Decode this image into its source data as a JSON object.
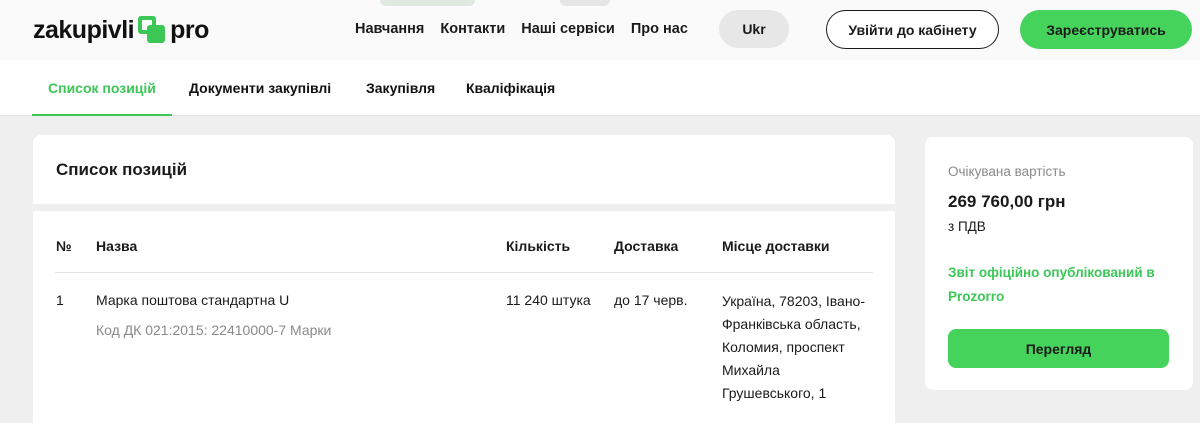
{
  "header": {
    "logo_left": "zakupivli",
    "logo_right": "pro",
    "nav": [
      "Навчання",
      "Контакти",
      "Наші сервіси",
      "Про нас"
    ],
    "lang": "Ukr",
    "login_label": "Увійти до кабінету",
    "register_label": "Зареєструватись"
  },
  "tabs": [
    {
      "label": "Список позицій",
      "active": true
    },
    {
      "label": "Документи закупівлі",
      "active": false
    },
    {
      "label": "Закупівля",
      "active": false
    },
    {
      "label": "Кваліфікація",
      "active": false
    }
  ],
  "items_card": {
    "title": "Список позицій",
    "columns": [
      "№",
      "Назва",
      "Кількість",
      "Доставка",
      "Місце доставки"
    ],
    "rows": [
      {
        "num": "1",
        "name": "Марка поштова стандартна U",
        "code": "Код ДК 021:2015: 22410000-7 Марки",
        "quantity": "11 240 штука",
        "delivery": "до 17 черв.",
        "address_lines": [
          "Україна, 78203, Івано-",
          "Франківська область,",
          "Коломия, проспект",
          "Михайла",
          "Грушевського, 1"
        ]
      }
    ]
  },
  "side": {
    "label": "Очікувана вартість",
    "amount": "269 760,00 грн",
    "vat": "з ПДВ",
    "report_text": "Звіт офіційно опублікований в Prozorro",
    "view_label": "Перегляд"
  },
  "colors": {
    "accent": "#3cc757",
    "button_green": "#45d35c",
    "page_bg": "#efefef"
  }
}
